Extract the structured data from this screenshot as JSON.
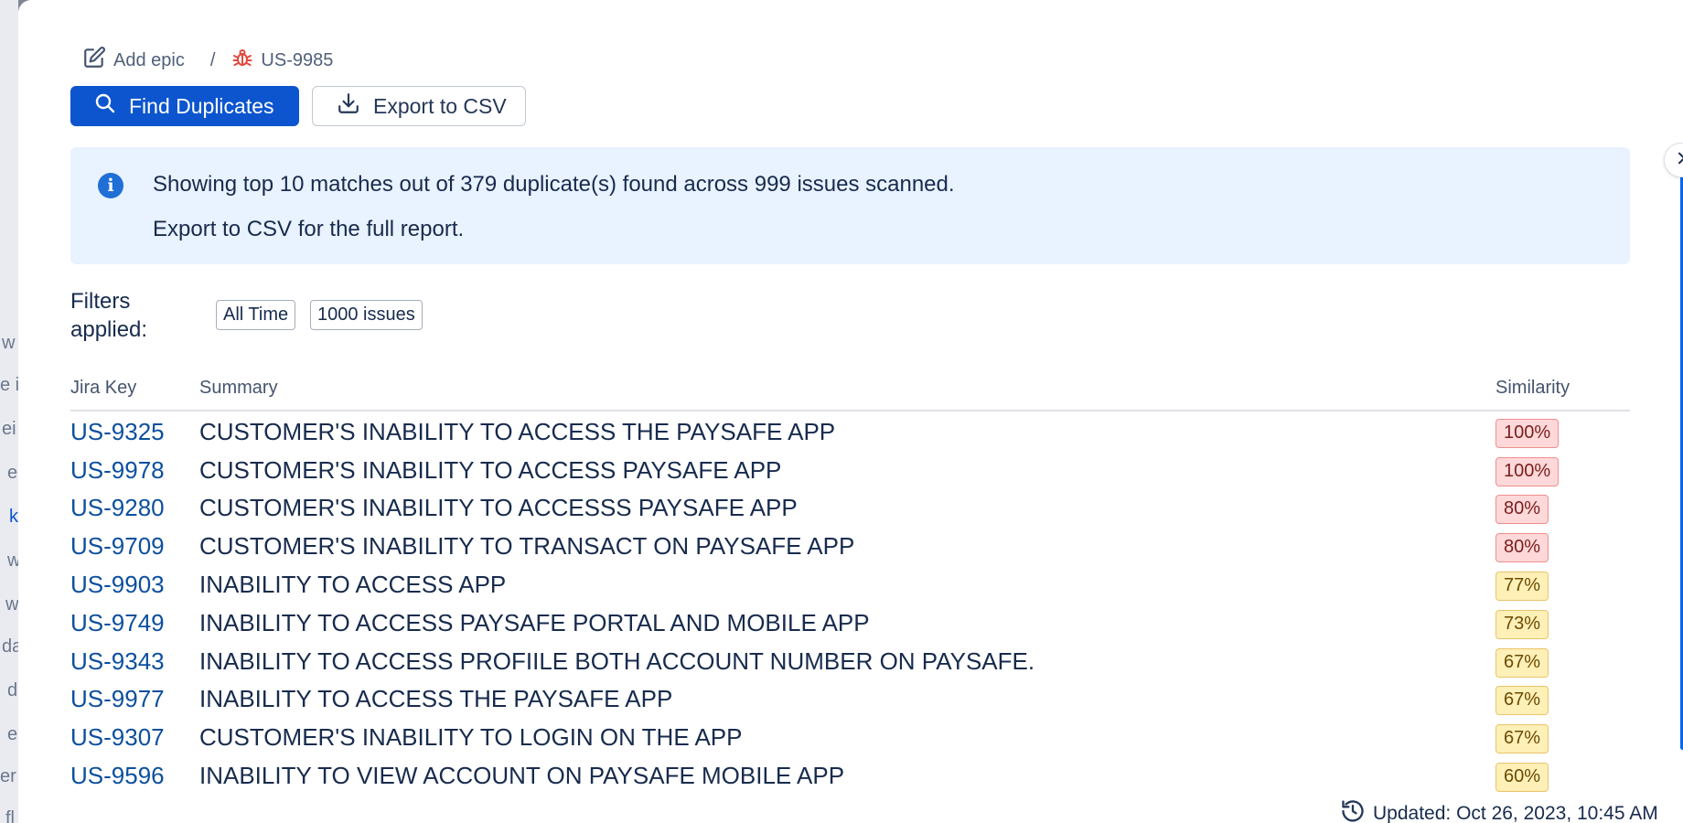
{
  "background": {
    "fragments": [
      "w",
      "e ii",
      "ei",
      "e",
      "k",
      "w",
      "w",
      "da",
      "d",
      "e",
      "er",
      "fl"
    ]
  },
  "breadcrumb": {
    "epic_label": "Add epic",
    "separator": "/",
    "issue_key": "US-9985",
    "epic_icon": "edit-icon",
    "issue_icon": "bug-icon"
  },
  "toolbar": {
    "find_label": "Find Duplicates",
    "export_label": "Export to CSV"
  },
  "info": {
    "line1": "Showing top 10 matches out of 379 duplicate(s) found across 999 issues scanned.",
    "line2": "Export to CSV for the full report."
  },
  "filters": {
    "label": "Filters applied:",
    "chips": [
      "All Time",
      "1000 issues"
    ]
  },
  "table": {
    "headers": {
      "key": "Jira Key",
      "summary": "Summary",
      "similarity": "Similarity"
    },
    "rows": [
      {
        "key": "US-9325",
        "summary": "CUSTOMER'S INABILITY TO ACCESS THE PAYSAFE APP",
        "similarity": "100%",
        "level": "high"
      },
      {
        "key": "US-9978",
        "summary": "CUSTOMER'S INABILITY TO ACCESS PAYSAFE APP",
        "similarity": "100%",
        "level": "high"
      },
      {
        "key": "US-9280",
        "summary": "CUSTOMER'S INABILITY TO ACCESSS PAYSAFE APP",
        "similarity": "80%",
        "level": "high"
      },
      {
        "key": "US-9709",
        "summary": "CUSTOMER'S INABILITY TO TRANSACT ON PAYSAFE APP",
        "similarity": "80%",
        "level": "high"
      },
      {
        "key": "US-9903",
        "summary": "INABILITY TO ACCESS APP",
        "similarity": "77%",
        "level": "mid"
      },
      {
        "key": "US-9749",
        "summary": "INABILITY TO ACCESS PAYSAFE PORTAL AND MOBILE APP",
        "similarity": "73%",
        "level": "mid"
      },
      {
        "key": "US-9343",
        "summary": "INABILITY TO ACCESS PROFIILE BOTH ACCOUNT NUMBER ON PAYSAFE.",
        "similarity": "67%",
        "level": "mid"
      },
      {
        "key": "US-9977",
        "summary": "INABILITY TO ACCESS THE PAYSAFE APP",
        "similarity": "67%",
        "level": "mid"
      },
      {
        "key": "US-9307",
        "summary": "CUSTOMER'S INABILITY TO LOGIN ON THE APP",
        "similarity": "67%",
        "level": "mid"
      },
      {
        "key": "US-9596",
        "summary": "INABILITY TO VIEW ACCOUNT ON PAYSAFE MOBILE APP",
        "similarity": "60%",
        "level": "mid"
      }
    ]
  },
  "footer": {
    "updated": "Updated: Oct 26, 2023, 10:45 AM"
  },
  "colors": {
    "primary": "#0c55cf",
    "link": "#0c4f9e",
    "info_bg": "#e9f2ff",
    "badge_high": "#ffd9d9",
    "badge_mid": "#fff0b8"
  }
}
